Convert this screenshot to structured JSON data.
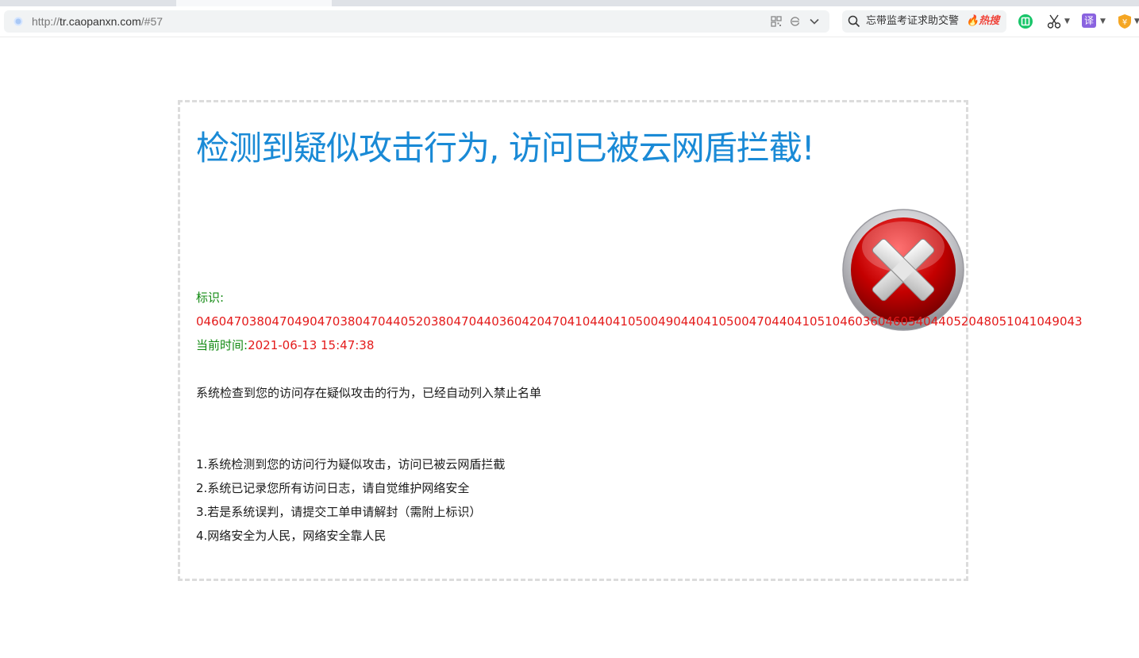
{
  "browser": {
    "url_scheme": "http://",
    "url_host": "tr.caopanxn.com",
    "url_path": "/#57",
    "search_query": "忘带监考证求助交警",
    "hot_label": "🔥热搜",
    "translate_label": "译",
    "accent_color": "#1a8ad6"
  },
  "page": {
    "title": "检测到疑似攻击行为, 访问已被云网盾拦截!",
    "id_label": "标识:",
    "id_value": "046047038047049047038047044052038047044036042047041044041050049044041050047044041051046036046054044052048051041049043",
    "time_label": "当前时间:",
    "time_value": "2021-06-13 15:47:38",
    "message": "系统检查到您的访问存在疑似攻击的行为，已经自动列入禁止名单",
    "items": [
      "1.系统检测到您的访问行为疑似攻击，访问已被云网盾拦截",
      "2.系统已记录您所有访问日志，请自觉维护网络安全",
      "3.若是系统误判，请提交工单申请解封（需附上标识）",
      "4.网络安全为人民，网络安全靠人民"
    ],
    "colors": {
      "title": "#1a8ad6",
      "label": "#128a12",
      "value": "#e41a1a",
      "error_icon": "#c40000"
    }
  }
}
